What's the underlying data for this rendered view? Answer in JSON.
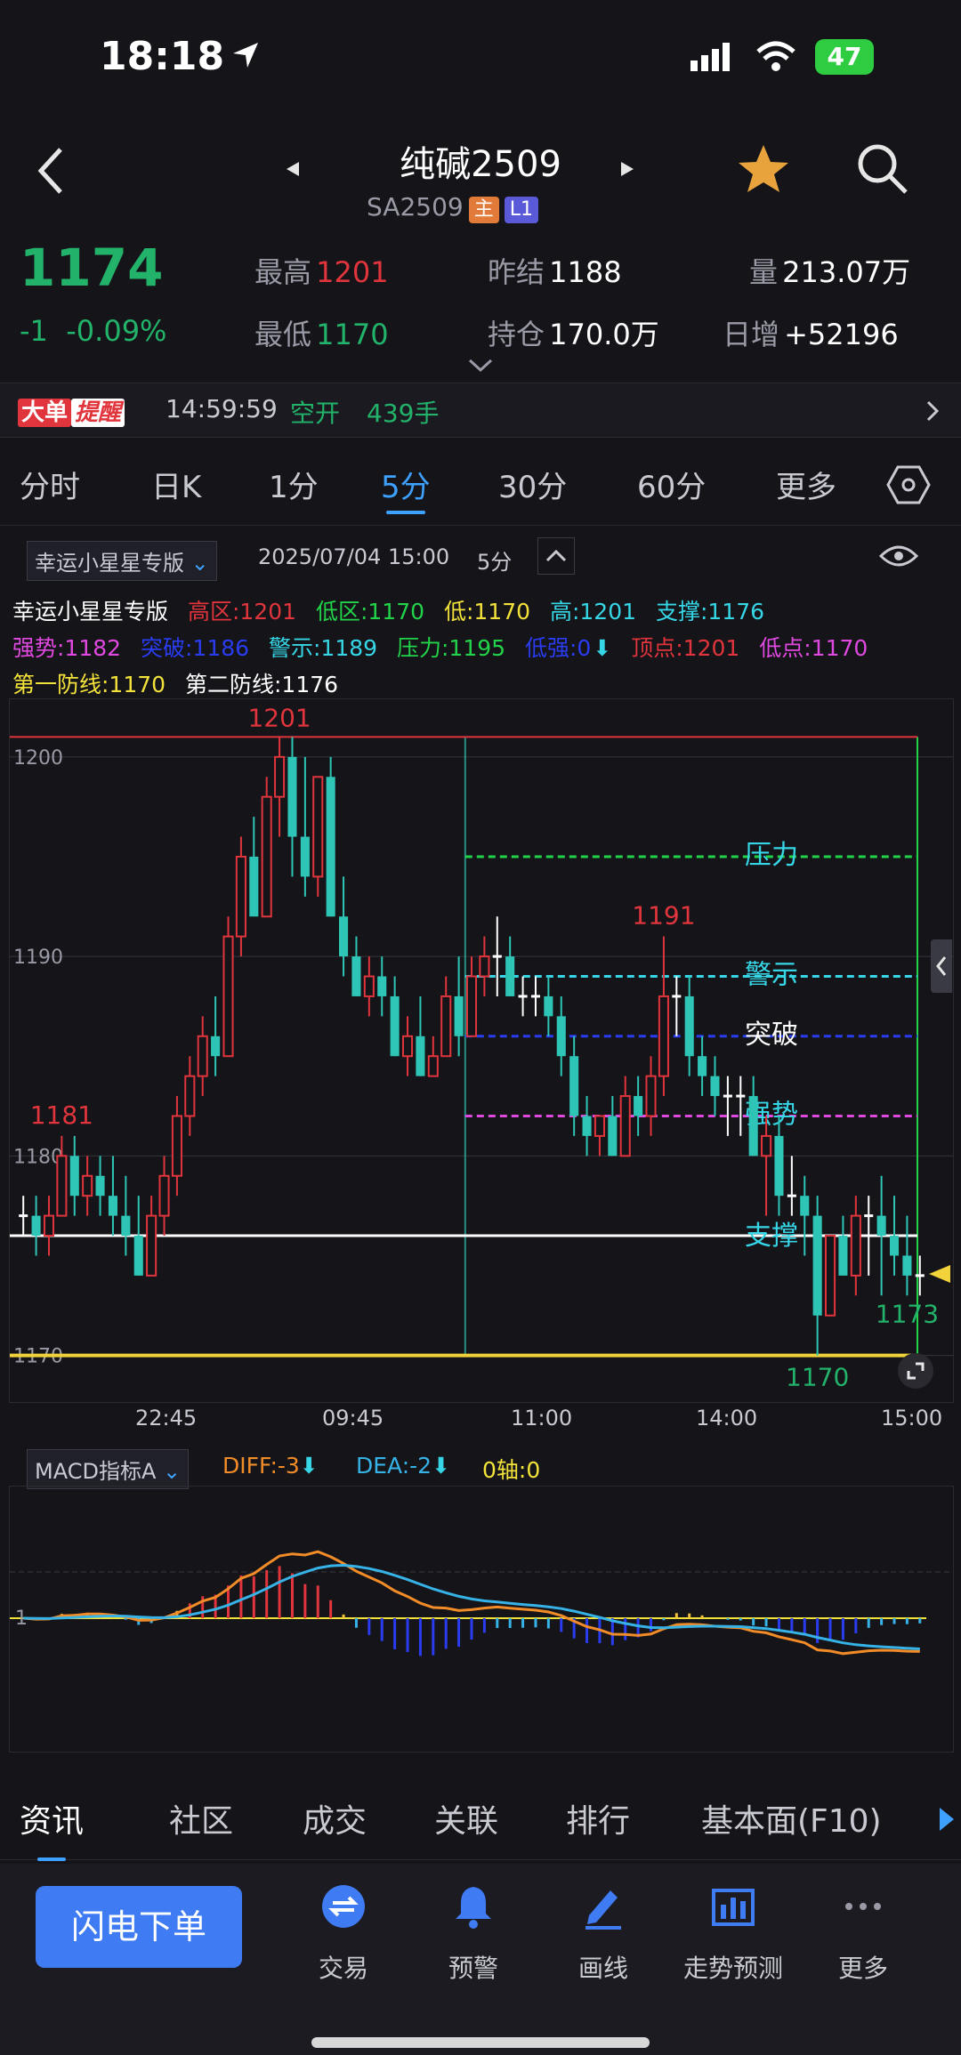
{
  "status_bar": {
    "time": "18:18",
    "battery": "47"
  },
  "header": {
    "title": "纯碱2509",
    "code": "SA2509",
    "badge_main": "主",
    "badge_l1": "L1"
  },
  "quote": {
    "price": "1174",
    "change": "-1",
    "change_pct": "-0.09%",
    "high_label": "最高",
    "high": "1201",
    "low_label": "最低",
    "low": "1170",
    "prev_settle_label": "昨结",
    "prev_settle": "1188",
    "open_interest_label": "持仓",
    "open_interest": "170.0万",
    "volume_label": "量",
    "volume": "213.07万",
    "daily_inc_label": "日增",
    "daily_inc": "+52196"
  },
  "alert": {
    "tag1": "大单",
    "tag2": "提醒",
    "time": "14:59:59",
    "type": "空开",
    "qty": "439手"
  },
  "period_tabs": [
    {
      "label": "分时"
    },
    {
      "label": "日K"
    },
    {
      "label": "1分"
    },
    {
      "label": "5分"
    },
    {
      "label": "30分"
    },
    {
      "label": "60分"
    },
    {
      "label": "更多"
    }
  ],
  "indicator_bar": {
    "selector": "幸运小星星专版",
    "datetime": "2025/07/04 15:00",
    "period": "5分"
  },
  "legend": {
    "name": "幸运小星星专版",
    "items_row1": [
      "高区:1201",
      "低区:1170",
      "低:1170",
      "高:1201",
      "支撑:1176"
    ],
    "items_row2": [
      "强势:1182",
      "突破:1186",
      "警示:1189",
      "压力:1195",
      "低强:0",
      "顶点:1201",
      "低点:1170"
    ],
    "items_row3": [
      "第一防线:1170",
      "第二防线:1176"
    ]
  },
  "chart_labels": {
    "y_ticks": [
      "1200",
      "1190",
      "1180",
      "1170"
    ],
    "x_ticks": [
      "22:45",
      "09:45",
      "11:00",
      "14:00",
      "15:00"
    ],
    "annotations": {
      "max": "1201",
      "m1191": "1191",
      "m1181": "1181",
      "min": "1170",
      "last": "1173"
    },
    "zone_labels": [
      "压力",
      "警示",
      "突破",
      "强势",
      "支撑"
    ]
  },
  "chart_data": {
    "type": "candlestick",
    "ylim": [
      1169,
      1202
    ],
    "candles": [
      [
        1177,
        1178,
        1176,
        1177
      ],
      [
        1177,
        1178,
        1175,
        1176
      ],
      [
        1176,
        1178,
        1175,
        1177
      ],
      [
        1177,
        1181,
        1177,
        1180
      ],
      [
        1180,
        1181,
        1177,
        1178
      ],
      [
        1178,
        1180,
        1177,
        1179
      ],
      [
        1179,
        1180,
        1177,
        1178
      ],
      [
        1178,
        1180,
        1176,
        1177
      ],
      [
        1177,
        1179,
        1175,
        1176
      ],
      [
        1176,
        1178,
        1174,
        1174
      ],
      [
        1174,
        1178,
        1174,
        1177
      ],
      [
        1177,
        1180,
        1176,
        1179
      ],
      [
        1179,
        1183,
        1178,
        1182
      ],
      [
        1182,
        1185,
        1181,
        1184
      ],
      [
        1184,
        1187,
        1183,
        1186
      ],
      [
        1186,
        1188,
        1184,
        1185
      ],
      [
        1185,
        1192,
        1185,
        1191
      ],
      [
        1191,
        1196,
        1190,
        1195
      ],
      [
        1195,
        1197,
        1193,
        1192
      ],
      [
        1192,
        1199,
        1192,
        1198
      ],
      [
        1198,
        1201,
        1196,
        1200
      ],
      [
        1200,
        1201,
        1194,
        1196
      ],
      [
        1196,
        1200,
        1193,
        1194
      ],
      [
        1194,
        1199,
        1193,
        1199
      ],
      [
        1199,
        1200,
        1192,
        1192
      ],
      [
        1192,
        1194,
        1189,
        1190
      ],
      [
        1190,
        1191,
        1188,
        1188
      ],
      [
        1188,
        1190,
        1187,
        1189
      ],
      [
        1189,
        1190,
        1187,
        1188
      ],
      [
        1188,
        1189,
        1185,
        1185
      ],
      [
        1185,
        1187,
        1184,
        1186
      ],
      [
        1186,
        1188,
        1184,
        1184
      ],
      [
        1184,
        1186,
        1184,
        1185
      ],
      [
        1185,
        1189,
        1185,
        1188
      ],
      [
        1188,
        1190,
        1185,
        1186
      ],
      [
        1186,
        1190,
        1186,
        1189
      ],
      [
        1189,
        1191,
        1188,
        1190
      ],
      [
        1190,
        1192,
        1188,
        1190
      ],
      [
        1190,
        1191,
        1188,
        1188
      ],
      [
        1188,
        1189,
        1187,
        1188
      ],
      [
        1188,
        1189,
        1187,
        1188
      ],
      [
        1188,
        1189,
        1186,
        1187
      ],
      [
        1187,
        1188,
        1184,
        1185
      ],
      [
        1185,
        1186,
        1181,
        1182
      ],
      [
        1182,
        1183,
        1180,
        1181
      ],
      [
        1181,
        1182,
        1180,
        1182
      ],
      [
        1182,
        1183,
        1180,
        1180
      ],
      [
        1180,
        1184,
        1180,
        1183
      ],
      [
        1183,
        1184,
        1181,
        1182
      ],
      [
        1182,
        1185,
        1181,
        1184
      ],
      [
        1184,
        1191,
        1183,
        1188
      ],
      [
        1188,
        1189,
        1186,
        1188
      ],
      [
        1188,
        1189,
        1184,
        1185
      ],
      [
        1185,
        1186,
        1183,
        1184
      ],
      [
        1184,
        1185,
        1182,
        1183
      ],
      [
        1183,
        1184,
        1181,
        1183
      ],
      [
        1183,
        1184,
        1181,
        1183
      ],
      [
        1183,
        1184,
        1180,
        1180
      ],
      [
        1180,
        1182,
        1177,
        1181
      ],
      [
        1181,
        1182,
        1177,
        1178
      ],
      [
        1178,
        1180,
        1177,
        1178
      ],
      [
        1178,
        1179,
        1175,
        1177
      ],
      [
        1177,
        1178,
        1170,
        1172
      ],
      [
        1172,
        1176,
        1172,
        1176
      ],
      [
        1176,
        1177,
        1174,
        1174
      ],
      [
        1174,
        1178,
        1173,
        1177
      ],
      [
        1177,
        1178,
        1174,
        1177
      ],
      [
        1177,
        1179,
        1173,
        1176
      ],
      [
        1176,
        1178,
        1174,
        1175
      ],
      [
        1175,
        1177,
        1173,
        1174
      ],
      [
        1174,
        1175,
        1173,
        1174
      ]
    ],
    "levels": {
      "high_zone": 1201,
      "pressure": 1195,
      "warning": 1189,
      "breakout": 1186,
      "strong": 1182,
      "support": 1176,
      "first_defense": 1170
    }
  },
  "macd_bar": {
    "selector": "MACD指标A",
    "diff": "DIFF:-3",
    "dea": "DEA:-2",
    "zero": "0轴:0",
    "tick": "1"
  },
  "bottom_tabs": [
    "资讯",
    "社区",
    "成交",
    "关联",
    "排行",
    "基本面(F10)"
  ],
  "toolbar": {
    "flash_order": "闪电下单",
    "items": [
      {
        "label": "交易"
      },
      {
        "label": "预警"
      },
      {
        "label": "画线"
      },
      {
        "label": "走势预测"
      },
      {
        "label": "更多"
      }
    ]
  },
  "colors": {
    "up": "#e0353c",
    "down": "#2ec5b6",
    "accent": "#3ea0ff",
    "green": "#22b26a"
  }
}
